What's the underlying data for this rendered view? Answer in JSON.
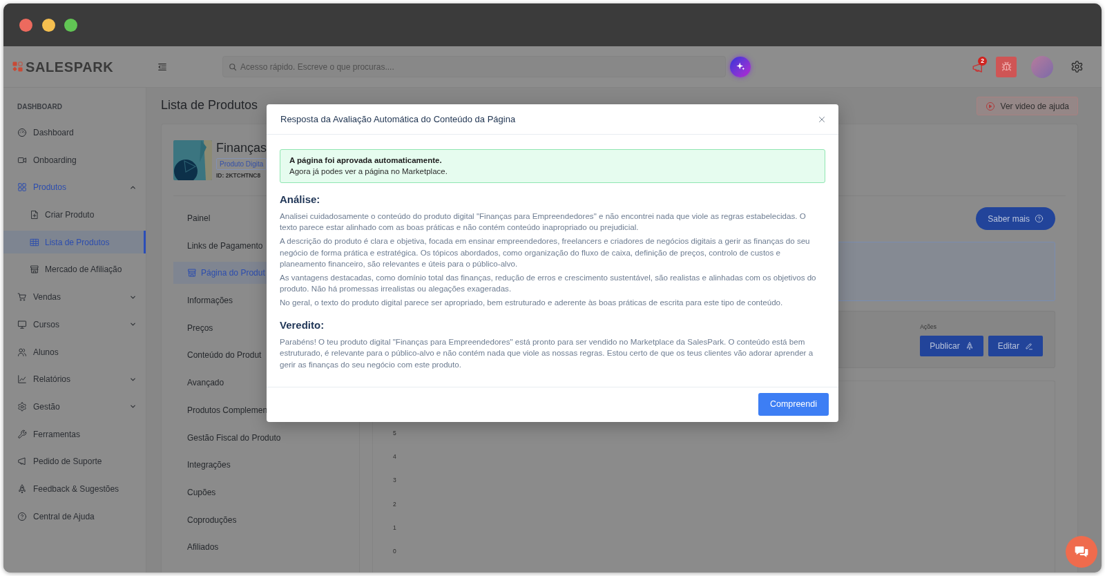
{
  "header": {
    "logo": "SALESPARK",
    "search": {
      "placeholder": "Acesso rápido. Escreve o que procuras...."
    },
    "notification_count": "2"
  },
  "sidebar": {
    "section_label": "DASHBOARD",
    "items": [
      {
        "label": "Dashboard",
        "selected": false
      },
      {
        "label": "Onboarding",
        "selected": false
      },
      {
        "label": "Produtos",
        "selected": true,
        "expanded": true,
        "children": [
          {
            "label": "Criar Produto",
            "selected": false
          },
          {
            "label": "Lista de Produtos",
            "selected": true
          },
          {
            "label": "Mercado de Afiliação",
            "selected": false
          }
        ]
      },
      {
        "label": "Vendas",
        "selected": false,
        "expanded": false
      },
      {
        "label": "Cursos",
        "selected": false,
        "expanded": false
      },
      {
        "label": "Alunos",
        "selected": false
      },
      {
        "label": "Relatórios",
        "selected": false,
        "expanded": false
      },
      {
        "label": "Gestão",
        "selected": false,
        "expanded": false
      },
      {
        "label": "Ferramentas",
        "selected": false
      },
      {
        "label": "Pedido de Suporte",
        "selected": false
      },
      {
        "label": "Feedback & Sugestões",
        "selected": false
      },
      {
        "label": "Central de Ajuda",
        "selected": false
      }
    ]
  },
  "page": {
    "title": "Lista de Produtos",
    "help_button": "Ver video de ajuda"
  },
  "product": {
    "name": "Finanças",
    "type": "Produto Digita",
    "id": "ID: 2KTCHTNC8"
  },
  "product_nav": [
    {
      "label": "Painel",
      "selected": false
    },
    {
      "label": "Links de Pagamento",
      "selected": false
    },
    {
      "label": "Página do Produt",
      "selected": true
    },
    {
      "label": "Informações",
      "selected": false
    },
    {
      "label": "Preços",
      "selected": false
    },
    {
      "label": "Conteúdo do Produt",
      "selected": false
    },
    {
      "label": "Avançado",
      "selected": false
    },
    {
      "label": "Produtos Complemen",
      "selected": false
    },
    {
      "label": "Gestão Fiscal do Produto",
      "selected": false
    },
    {
      "label": "Integrações",
      "selected": false
    },
    {
      "label": "Cupões",
      "selected": false
    },
    {
      "label": "Coproduções",
      "selected": false
    },
    {
      "label": "Afiliados",
      "selected": false
    }
  ],
  "product_panel": {
    "learn_more_button": "Saber mais",
    "actions_label": "Ações",
    "actions": [
      "Publicar",
      "Editar"
    ],
    "chart": {
      "axis_labels": [
        "5",
        "4",
        "3",
        "2",
        "1",
        "0"
      ]
    }
  },
  "modal": {
    "title": "Resposta da Avaliação Automática do Conteúdo da Página",
    "alert": {
      "title": "A página foi aprovada automaticamente.",
      "message": "Agora já podes ver a página no Marketplace."
    },
    "sections": [
      {
        "heading": "Análise:",
        "paragraphs": [
          "Analisei cuidadosamente o conteúdo do produto digital \"Finanças para Empreendedores\" e não encontrei nada que viole as regras estabelecidas. O texto parece estar alinhado com as boas práticas e não contém conteúdo inapropriado ou prejudicial.",
          "A descrição do produto é clara e objetiva, focada em ensinar empreendedores, freelancers e criadores de negócios digitais a gerir as finanças do seu negócio de forma prática e estratégica. Os tópicos abordados, como organização do fluxo de caixa, definição de preços, controlo de custos e planeamento financeiro, são relevantes e úteis para o público-alvo.",
          "As vantagens destacadas, como domínio total das finanças, redução de erros e crescimento sustentável, são realistas e alinhadas com os objetivos do produto. Não há promessas irrealistas ou alegações exageradas.",
          "No geral, o texto do produto digital parece ser apropriado, bem estruturado e aderente às boas práticas de escrita para este tipo de conteúdo."
        ]
      },
      {
        "heading": "Veredito:",
        "paragraphs": [
          "Parabéns! O teu produto digital \"Finanças para Empreendedores\" está pronto para ser vendido no Marketplace da SalesPark. O conteúdo está bem estruturado, é relevante para o público-alvo e não contém nada que viole as nossas regras. Estou certo de que os teus clientes vão adorar aprender a gerir as finanças do seu negócio com este produto."
        ]
      }
    ],
    "button": "Compreendi"
  }
}
